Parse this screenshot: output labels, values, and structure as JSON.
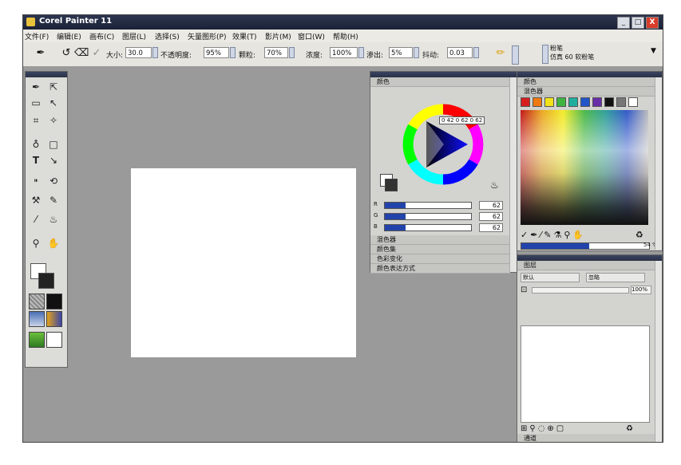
{
  "window": {
    "title": "Corel Painter 11",
    "minimize": "_",
    "maximize": "□",
    "close": "X"
  },
  "menu": [
    "文件(F)",
    "编辑(E)",
    "画布(C)",
    "图层(L)",
    "选择(S)",
    "矢量图形(P)",
    "效果(T)",
    "影片(M)",
    "窗口(W)",
    "帮助(H)"
  ],
  "propbar": {
    "size_label": "大小:",
    "size_value": "30.0",
    "opacity_label": "不透明度:",
    "opacity_value": "95%",
    "grain_label": "颗粒:",
    "grain_value": "70%",
    "resat_label": "浓度:",
    "resat_value": "100%",
    "bleed_label": "渗出:",
    "bleed_value": "5%",
    "jitter_label": "抖动:",
    "jitter_value": "0.03",
    "brush_category": "粉笔",
    "brush_variant": "仿真 60 软粉笔"
  },
  "color_panel": {
    "title": "颜色",
    "hsv_readout": "0 42 0 62 0 62",
    "sliders": [
      {
        "label": "R",
        "value": "62",
        "fraction": 0.24
      },
      {
        "label": "G",
        "value": "62",
        "fraction": 0.24
      },
      {
        "label": "B",
        "value": "62",
        "fraction": 0.24
      }
    ],
    "sections": [
      "混色器",
      "颜色集",
      "色彩变化",
      "颜色表达方式"
    ]
  },
  "mixer_panel": {
    "title": "颜色",
    "subtitle": "混色器",
    "swatches": [
      "#d62020",
      "#f07a10",
      "#f2e21a",
      "#3fb53f",
      "#1fae9e",
      "#2255c8",
      "#6a2ea8",
      "#111111",
      "#777777",
      "#ffffff"
    ],
    "zoom": "54 %"
  },
  "layers_panel": {
    "title": "图层",
    "composite_method": "默认",
    "composite_depth": "忽略",
    "opacity_value": "100%",
    "channels_title": "通道"
  }
}
